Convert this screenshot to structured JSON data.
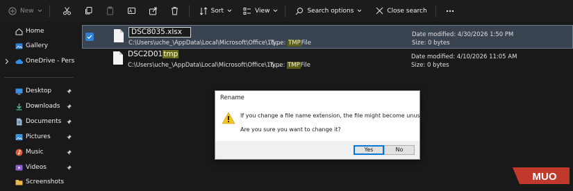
{
  "toolbar": {
    "new_label": "New",
    "sort_label": "Sort",
    "view_label": "View",
    "search_options_label": "Search options",
    "close_search_label": "Close search"
  },
  "sidebar": {
    "items": [
      {
        "label": "Home",
        "icon": "home-icon"
      },
      {
        "label": "Gallery",
        "icon": "gallery-icon"
      },
      {
        "label": "OneDrive - Personal",
        "icon": "cloud-icon"
      },
      {
        "label": "Desktop",
        "icon": "desktop-icon"
      },
      {
        "label": "Downloads",
        "icon": "download-icon"
      },
      {
        "label": "Documents",
        "icon": "documents-icon"
      },
      {
        "label": "Pictures",
        "icon": "pictures-icon"
      },
      {
        "label": "Music",
        "icon": "music-icon"
      },
      {
        "label": "Videos",
        "icon": "videos-icon"
      },
      {
        "label": "Screenshots",
        "icon": "folder-icon"
      }
    ]
  },
  "files": [
    {
      "name": "DSC8035.xlsx",
      "path": "C:\\Users\\uche_\\AppData\\Local\\Microsoft\\Office\\16....",
      "type_label": "Type:",
      "type_highlight": "TMP",
      "type_suffix": "File",
      "date": "Date modified: 4/30/2026 1:50 PM",
      "size": "Size: 0 bytes"
    },
    {
      "name_prefix": "DSC2D01",
      "name_highlight": "tmp",
      "path": "C:\\Users\\uche_\\AppData\\Local\\Microsoft\\Office\\16....",
      "type_label": "Type:",
      "type_highlight": "TMP",
      "type_suffix": "File",
      "date": "Date modified: 4/10/2026 11:05 AM",
      "size": "Size: 0 bytes"
    }
  ],
  "dialog": {
    "title": "Rename",
    "message": "If you change a file name extension, the file might become unusable.",
    "question": "Are you sure you want to change it?",
    "yes_label": "Yes",
    "no_label": "No"
  },
  "watermark": {
    "text": "MUO"
  },
  "colors": {
    "accent": "#2f7fd6",
    "selection": "#3a4350",
    "highlight": "#5b5b1a",
    "logo": "#c0392b"
  }
}
